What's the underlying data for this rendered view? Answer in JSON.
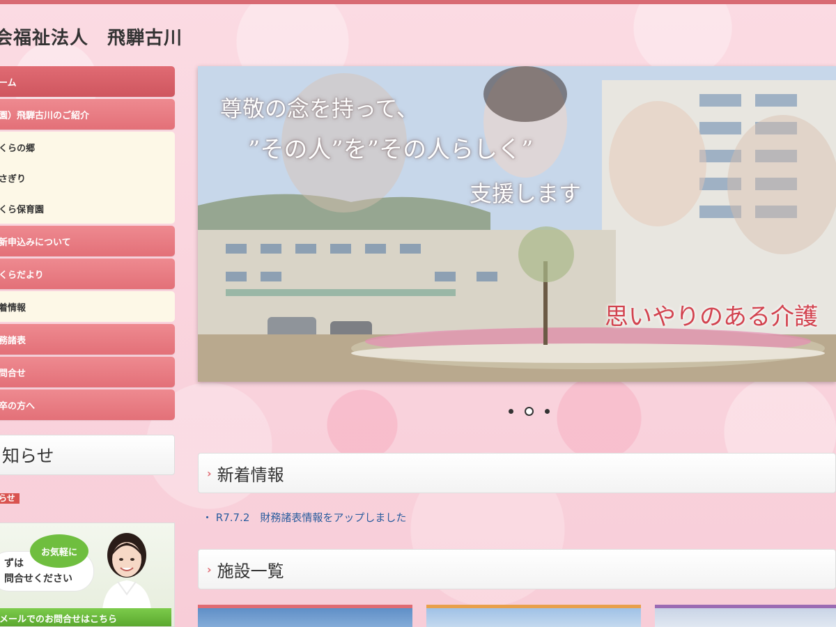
{
  "site": {
    "title": "会福祉法人　飛騨古川"
  },
  "nav": {
    "items": [
      {
        "label": "ーム",
        "type": "main",
        "active": true
      },
      {
        "label": "園）飛騨古川のご紹介",
        "type": "main"
      },
      {
        "label": "くらの郷",
        "type": "sub"
      },
      {
        "label": "さぎり",
        "type": "sub"
      },
      {
        "label": "くら保育園",
        "type": "sub"
      },
      {
        "label": "新申込みについて",
        "type": "main"
      },
      {
        "label": "くらだより",
        "type": "main"
      },
      {
        "label": "着情報",
        "type": "sub"
      },
      {
        "label": "務諸表",
        "type": "main"
      },
      {
        "label": "問合せ",
        "type": "main"
      },
      {
        "label": "卒の方へ",
        "type": "main"
      }
    ]
  },
  "sidebar": {
    "notice_title": "知らせ",
    "notice_label": "らせ",
    "contact": {
      "bubble_green": "お気軽に",
      "bubble_line1": "ずは",
      "bubble_line2": "問合せください",
      "mail_button": "メールでのお問合せはこちら"
    }
  },
  "slider": {
    "caption_line1": "尊敬の念を持って、",
    "caption_line2": "”その人”を”その人らしく”",
    "caption_line3": "支援します",
    "caption_bottom": "思いやりのある介護",
    "active_index": 1,
    "slide_count": 3
  },
  "main": {
    "news_title": "新着情報",
    "news_items": [
      {
        "text": "・ R7.7.2　財務諸表情報をアップしました"
      }
    ],
    "facilities_title": "施設一覧"
  },
  "colors": {
    "accent": "#e06b73",
    "top_bar": "#d86a73",
    "link": "#2a5d9e",
    "mail_green": "#6fbe3f"
  }
}
